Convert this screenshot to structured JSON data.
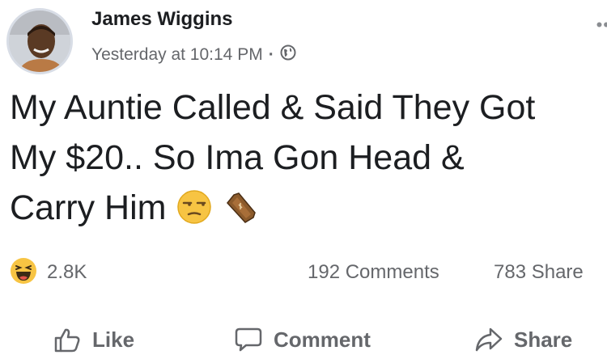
{
  "post": {
    "author": "James Wiggins",
    "timestamp": "Yesterday at 10:14 PM",
    "privacy_icon": "globe-icon",
    "more_label": "••",
    "text_lines": [
      "My Auntie Called & Said They Got",
      "My $20.. So Ima Gon Head &",
      "Carry Him"
    ],
    "emojis": [
      "unamused-face-emoji",
      "coffin-emoji"
    ]
  },
  "stats": {
    "reaction_icon": "haha-reaction-icon",
    "reaction_count": "2.8K",
    "comments": "192 Comments",
    "shares": "783 Share"
  },
  "actions": {
    "like": "Like",
    "comment": "Comment",
    "share": "Share"
  }
}
